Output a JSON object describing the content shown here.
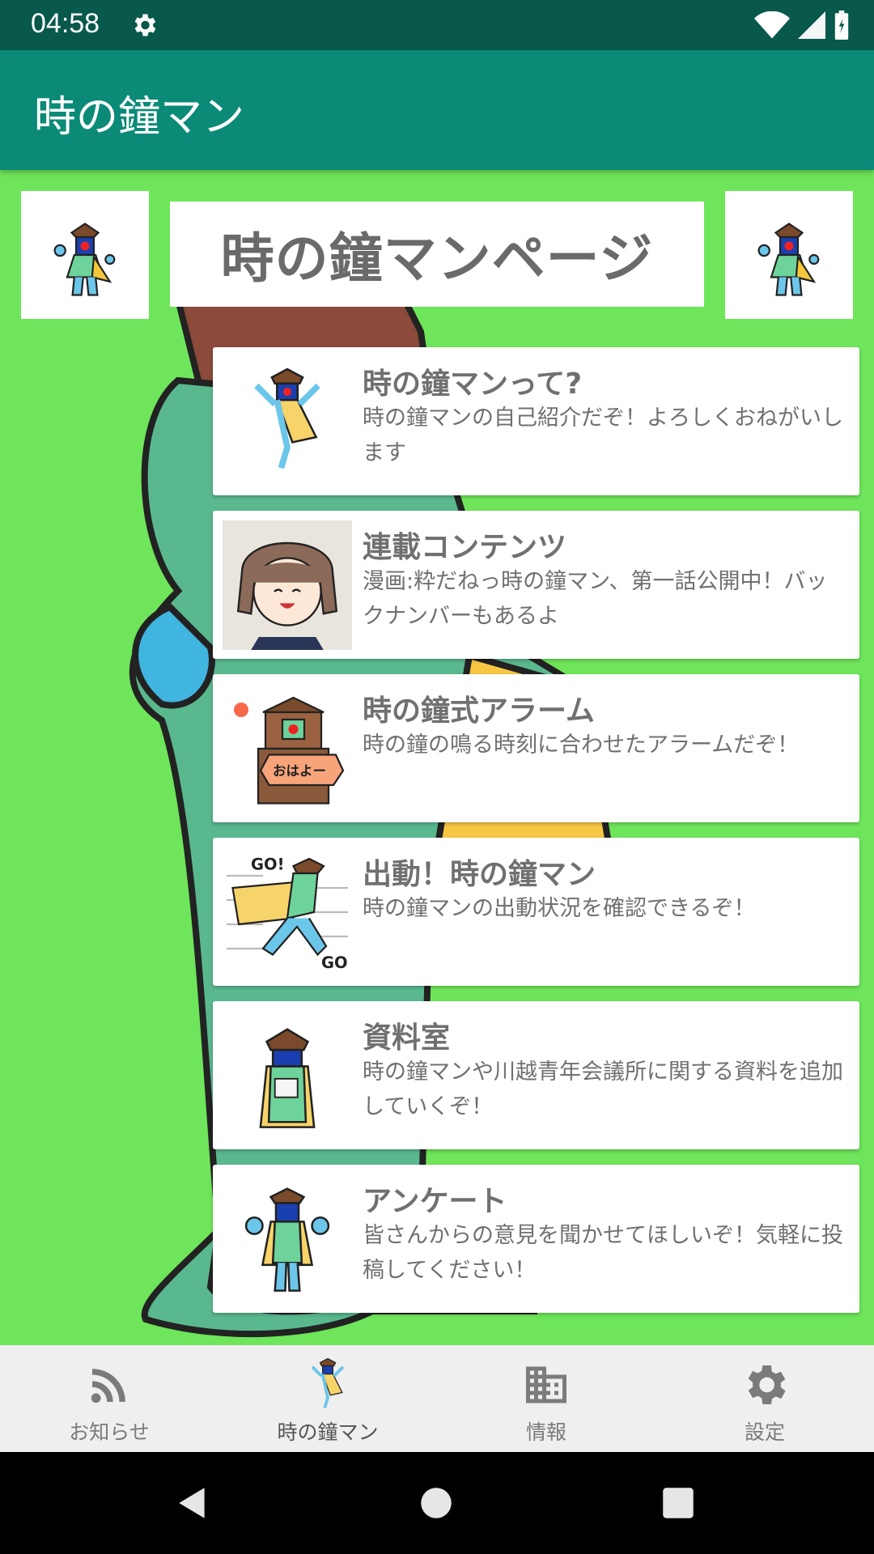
{
  "status_bar": {
    "time": "04:58",
    "icons": [
      "gear-icon",
      "wifi-icon",
      "signal-icon",
      "battery-icon"
    ]
  },
  "app_bar": {
    "title": "時の鐘マン"
  },
  "header": {
    "banner_title": "時の鐘マンページ"
  },
  "cards": [
    {
      "title": "時の鐘マンって?",
      "description": "時の鐘マンの自己紹介だぞ！よろしくおねがいします",
      "image": "mascot-thumbsup"
    },
    {
      "title": "連載コンテンツ",
      "description": "漫画:粋だねっ時の鐘マン、第一話公開中！バックナンバーもあるよ",
      "image": "manga-girl"
    },
    {
      "title": "時の鐘式アラーム",
      "description": "時の鐘の鳴る時刻に合わせたアラームだぞ！",
      "image": "ohayo-tower",
      "badge": "おはよー"
    },
    {
      "title": "出動！時の鐘マン",
      "description": "時の鐘マンの出動状況を確認できるぞ！",
      "image": "running-mascot",
      "badge_top": "GO!",
      "badge_bottom": "GO!"
    },
    {
      "title": "資料室",
      "description": "時の鐘マンや川越青年会議所に関する資料を追加していくぞ！",
      "image": "reading-mascot"
    },
    {
      "title": "アンケート",
      "description": "皆さんからの意見を聞かせてほしいぞ！気軽に投稿してください！",
      "image": "waving-mascot"
    }
  ],
  "bottom_nav": [
    {
      "label": "お知らせ",
      "icon": "rss-icon"
    },
    {
      "label": "時の鐘マン",
      "icon": "mascot-icon",
      "active": true
    },
    {
      "label": "情報",
      "icon": "building-icon"
    },
    {
      "label": "設定",
      "icon": "gear-icon"
    }
  ],
  "colors": {
    "status_bar": "#08584c",
    "app_bar": "#0b8a78",
    "background": "#6ee55a",
    "card_text": "#707070"
  }
}
